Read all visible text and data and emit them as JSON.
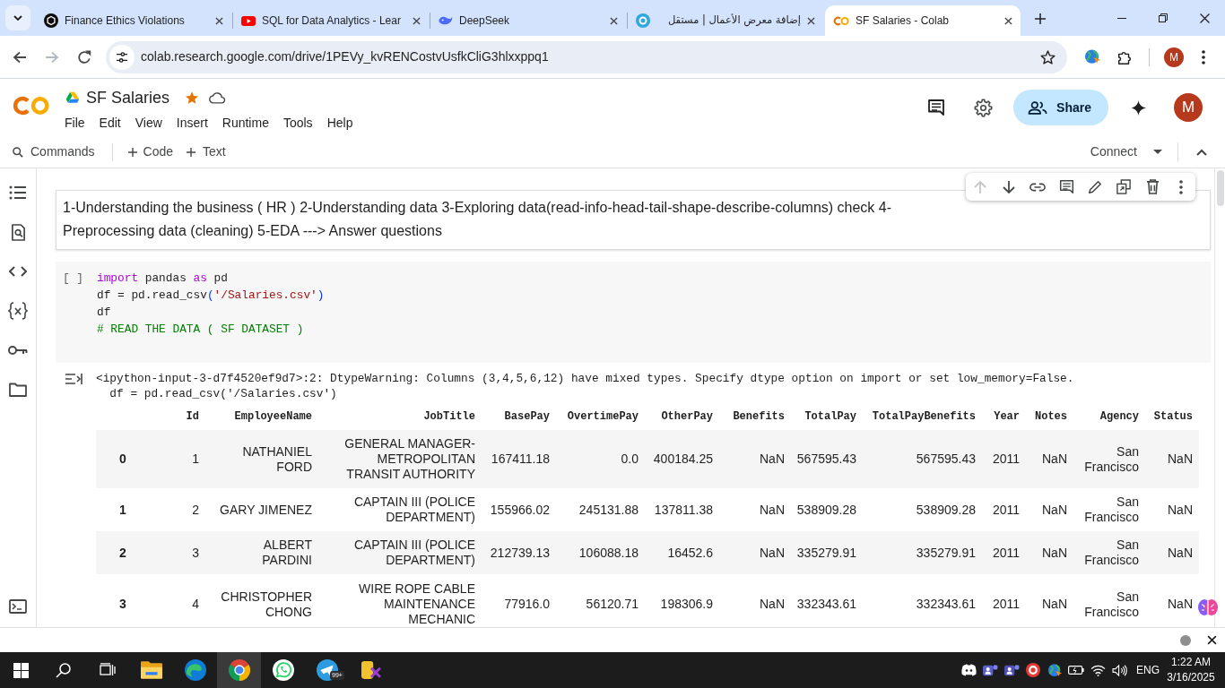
{
  "browser": {
    "tabs": [
      {
        "title": "Finance Ethics Violations",
        "selected": false
      },
      {
        "title": "SQL for Data Analytics - Lear",
        "selected": false
      },
      {
        "title": "DeepSeek",
        "selected": false
      },
      {
        "title": "إضافة معرض الأعمال | مستقل",
        "selected": false
      },
      {
        "title": "SF Salaries - Colab",
        "selected": true
      }
    ],
    "nav_buttons": [
      {
        "disabled": false
      },
      {
        "disabled": true
      }
    ],
    "url": "colab.research.google.com/drive/1PEVy_kvRENCostvUsfkCliG3hlxxppq1",
    "profile": "M"
  },
  "notebook": {
    "title": "SF Salaries",
    "starred": true,
    "menu": [
      "File",
      "Edit",
      "View",
      "Insert",
      "Runtime",
      "Tools",
      "Help"
    ],
    "share": "Share",
    "account": "M"
  },
  "toolbar": {
    "commands": "Commands",
    "insert_code": "Code",
    "insert_text": "Text",
    "connect": "Connect"
  },
  "text_cell": {
    "text": "1-Understanding the business ( HR ) 2-Understanding data 3-Exploring data(read-info-head-tail-shape-describe-columns) check 4-Preprocessing data (cleaning) 5-EDA ---> Answer questions",
    "actions": [
      {
        "disabled": true
      },
      {
        "disabled": false
      },
      {
        "disabled": false
      },
      {
        "disabled": false
      },
      {
        "disabled": false
      },
      {
        "disabled": false
      },
      {
        "disabled": false
      },
      {
        "disabled": false
      }
    ]
  },
  "code_cell": {
    "prompt": "[ ]",
    "lines": [
      {
        "tokens": [
          {
            "text": "import",
            "kind": "keyword"
          },
          {
            "text": " pandas ",
            "kind": "plain"
          },
          {
            "text": "as",
            "kind": "keyword"
          },
          {
            "text": " pd",
            "kind": "plain"
          }
        ]
      },
      {
        "tokens": [
          {
            "text": "df = pd.read_csv",
            "kind": "plain"
          },
          {
            "text": "(",
            "kind": "bracket"
          },
          {
            "text": "'/Salaries.csv'",
            "kind": "string"
          },
          {
            "text": ")",
            "kind": "bracket"
          }
        ]
      },
      {
        "tokens": [
          {
            "text": "df",
            "kind": "plain"
          }
        ]
      },
      {
        "tokens": [
          {
            "text": "# READ THE DATA ( SF DATASET )",
            "kind": "comment"
          }
        ]
      }
    ]
  },
  "output": {
    "lines": [
      "<ipython-input-3-d7f4520ef9d7>:2: DtypeWarning: Columns (3,4,5,6,12) have mixed types. Specify dtype option on import or set low_memory=False.",
      "  df = pd.read_csv('/Salaries.csv')"
    ],
    "table": {
      "columns": [
        "Id",
        "EmployeeName",
        "JobTitle",
        "BasePay",
        "OvertimePay",
        "OtherPay",
        "Benefits",
        "TotalPay",
        "TotalPayBenefits",
        "Year",
        "Notes",
        "Agency",
        "Status"
      ],
      "rows": [
        {
          "index": "0",
          "cells": [
            "1",
            "NATHANIEL FORD",
            "GENERAL MANAGER-METROPOLITAN TRANSIT AUTHORITY",
            "167411.18",
            "0.0",
            "400184.25",
            "NaN",
            "567595.43",
            "567595.43",
            "2011",
            "NaN",
            "San Francisco",
            "NaN"
          ]
        },
        {
          "index": "1",
          "cells": [
            "2",
            "GARY JIMENEZ",
            "CAPTAIN III (POLICE DEPARTMENT)",
            "155966.02",
            "245131.88",
            "137811.38",
            "NaN",
            "538909.28",
            "538909.28",
            "2011",
            "NaN",
            "San Francisco",
            "NaN"
          ]
        },
        {
          "index": "2",
          "cells": [
            "3",
            "ALBERT PARDINI",
            "CAPTAIN III (POLICE DEPARTMENT)",
            "212739.13",
            "106088.18",
            "16452.6",
            "NaN",
            "335279.91",
            "335279.91",
            "2011",
            "NaN",
            "San Francisco",
            "NaN"
          ]
        },
        {
          "index": "3",
          "cells": [
            "4",
            "CHRISTOPHER CHONG",
            "WIRE ROPE CABLE MAINTENANCE MECHANIC",
            "77916.0",
            "56120.71",
            "198306.9",
            "NaN",
            "332343.61",
            "332343.61",
            "2011",
            "NaN",
            "San Francisco",
            "NaN"
          ]
        }
      ]
    }
  },
  "taskbar": {
    "apps": [
      {
        "selected": false
      },
      {
        "selected": false
      },
      {
        "selected": true
      },
      {
        "selected": false
      },
      {
        "selected": false,
        "badge": "99+"
      },
      {
        "selected": false
      }
    ],
    "language": "ENG",
    "time": "1:22 AM",
    "date": "3/16/2025"
  }
}
